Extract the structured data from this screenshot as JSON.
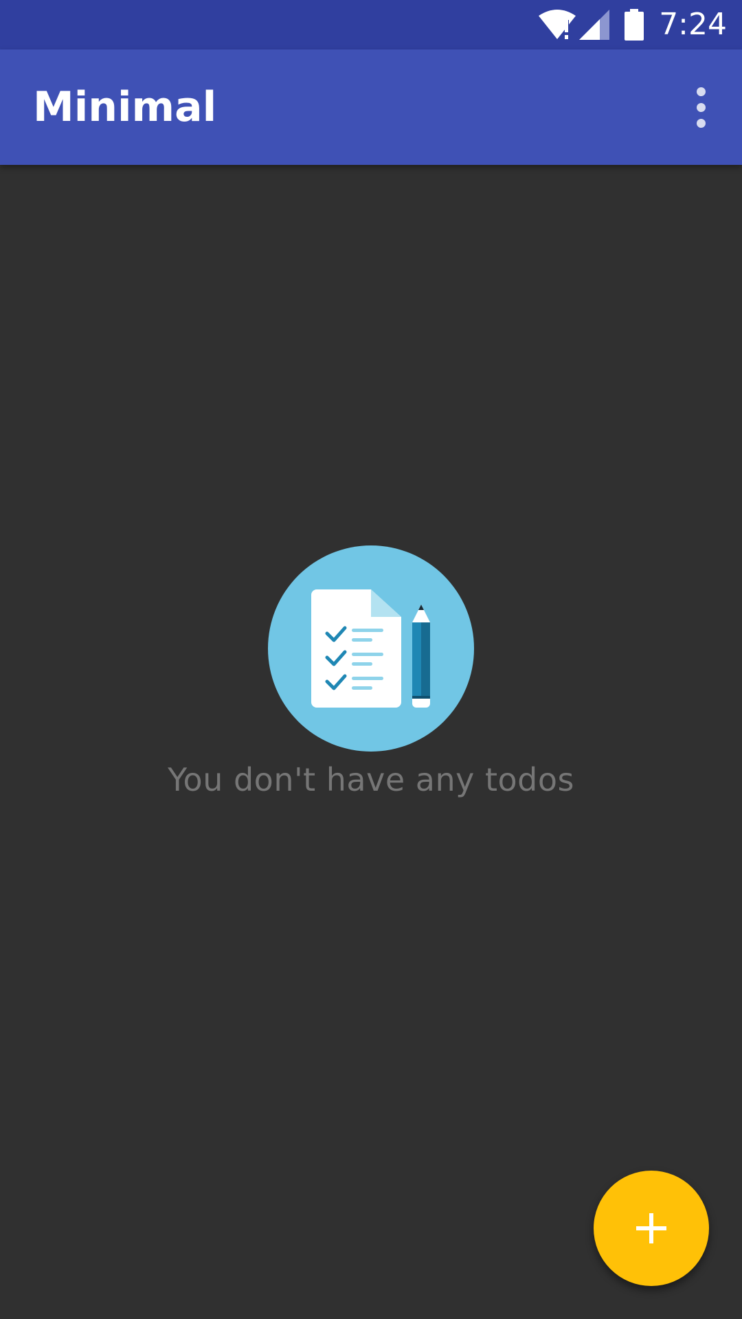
{
  "status_bar": {
    "time": "7:24",
    "icons": [
      "wifi-alert-icon",
      "cellular-signal-icon",
      "battery-full-icon"
    ]
  },
  "app_bar": {
    "title": "Minimal",
    "overflow_icon": "more-vert-icon"
  },
  "empty_state": {
    "illustration": "checklist-with-pencil-icon",
    "message": "You don't have any todos"
  },
  "fab": {
    "icon": "plus-icon"
  },
  "colors": {
    "status_bar": "#303F9F",
    "app_bar": "#3F51B5",
    "background": "#303030",
    "fab": "#FFC107",
    "illustration_circle": "#71C6E5",
    "empty_text": "#767676"
  }
}
